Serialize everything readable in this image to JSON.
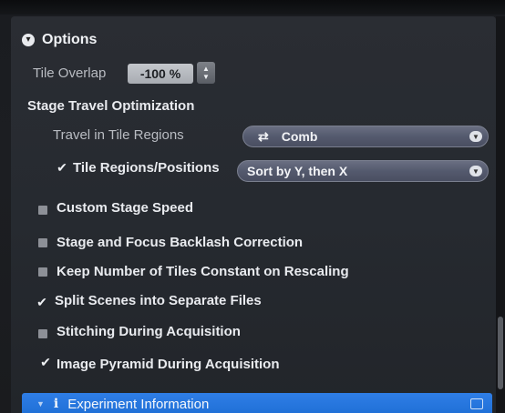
{
  "options": {
    "header": "Options",
    "tile_overlap": {
      "label": "Tile Overlap",
      "value": "-100 %"
    },
    "stage_travel": {
      "title": "Stage Travel Optimization",
      "travel_label": "Travel in Tile Regions",
      "travel_value": "Comb",
      "tile_regions_label": "Tile Regions/Positions",
      "tile_regions_checked": true,
      "tile_regions_value": "Sort by Y, then X"
    },
    "checkboxes": [
      {
        "label": "Custom Stage Speed",
        "checked": false
      },
      {
        "label": "Stage and Focus Backlash Correction",
        "checked": false
      },
      {
        "label": "Keep Number of Tiles Constant on Rescaling",
        "checked": false
      },
      {
        "label": "Split Scenes into Separate Files",
        "checked": true
      },
      {
        "label": "Stitching During Acquisition",
        "checked": false
      },
      {
        "label": "Image Pyramid During Acquisition",
        "checked": true
      }
    ]
  },
  "footer": {
    "label": "Experiment Information"
  },
  "colors": {
    "accent_blue": "#2a78e0",
    "panel_bg": "#262a30",
    "dropdown_bg": "#545a6e"
  },
  "icons": {
    "collapse": "collapse-circle-icon",
    "comb": "comb-arrows-icon",
    "info": "info-icon",
    "expand": "expand-window-icon"
  }
}
